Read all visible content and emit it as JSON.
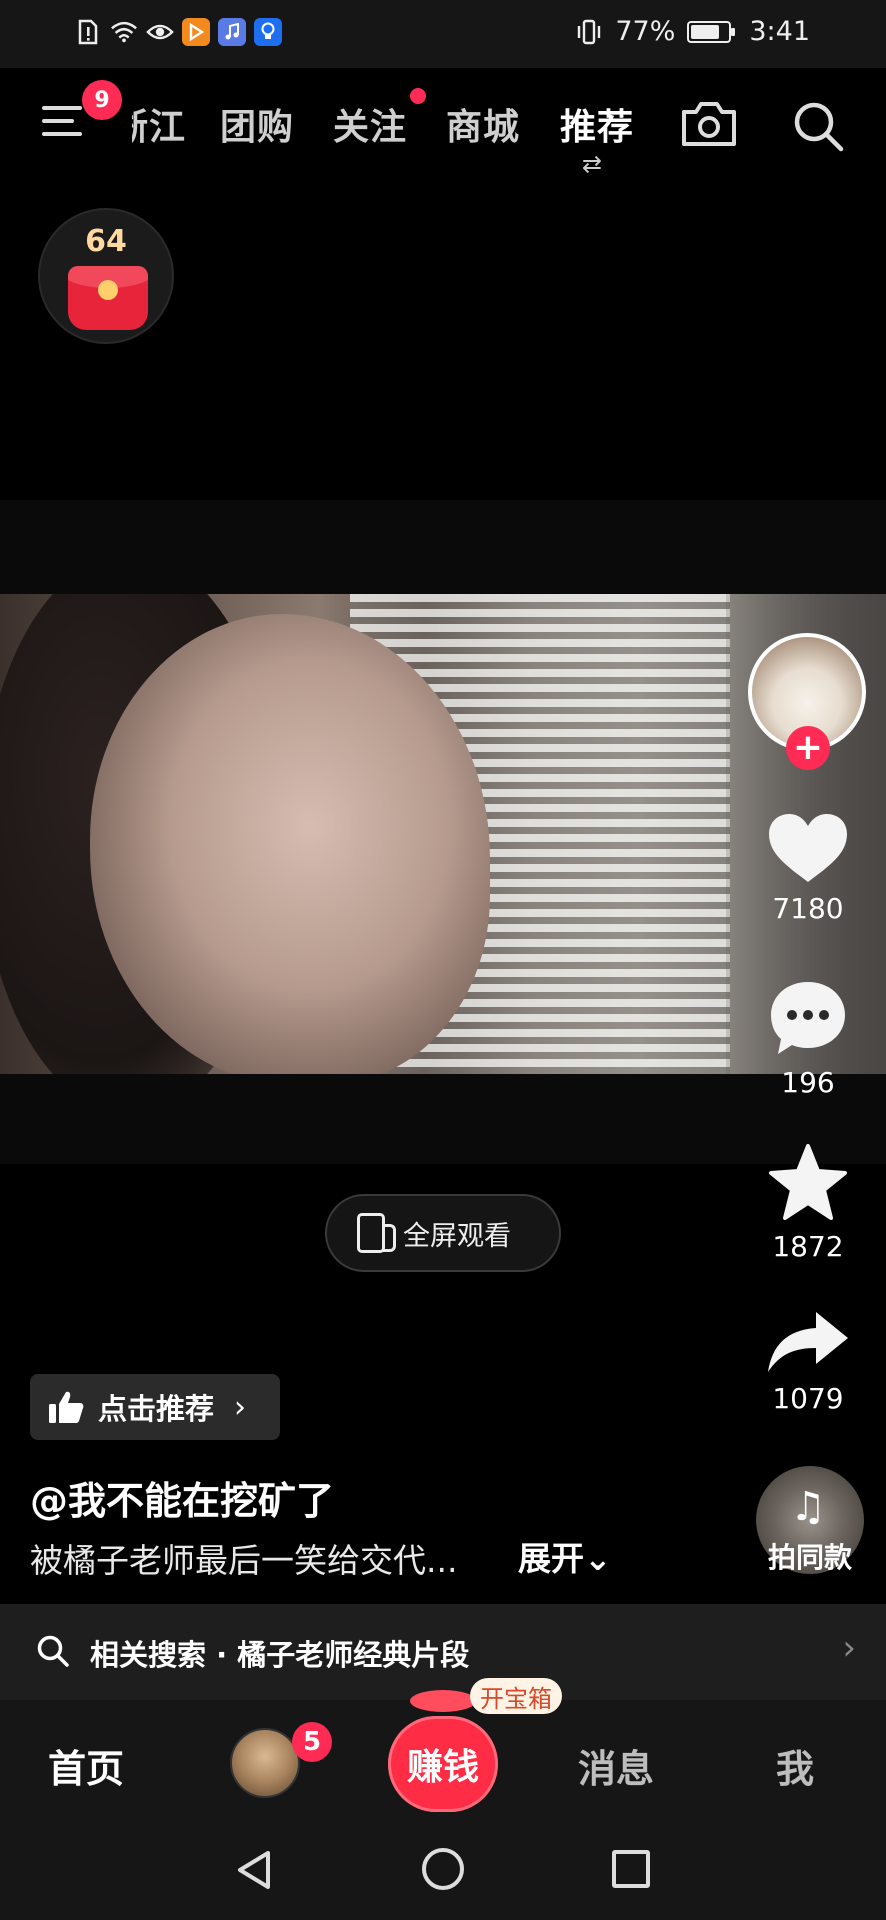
{
  "status_bar": {
    "battery_percent": "77%",
    "battery_level": 0.77,
    "time": "3:41",
    "icons": [
      "sim-alert-icon",
      "wifi-icon",
      "eye-comfort-icon",
      "app-play-icon",
      "app-music-icon",
      "app-bulb-icon",
      "vibrate-icon"
    ]
  },
  "top_nav": {
    "menu_badge": "9",
    "tabs": [
      {
        "label": "浙江",
        "active": false
      },
      {
        "label": "团购",
        "active": false
      },
      {
        "label": "关注",
        "active": false,
        "has_dot": true
      },
      {
        "label": "商城",
        "active": false
      },
      {
        "label": "推荐",
        "active": true
      }
    ],
    "switch_glyph": "⇄",
    "icons": [
      "camera-icon",
      "search-icon"
    ]
  },
  "red_packet": {
    "count": "64"
  },
  "video": {
    "fullscreen_label": "全屏观看"
  },
  "right_rail": {
    "follow_glyph": "+",
    "likes": "7180",
    "comments": "196",
    "favorites": "1872",
    "shares": "1079",
    "music_label": "拍同款",
    "music_glyph": "♫"
  },
  "info": {
    "recommend_label": "点击推荐",
    "recommend_chevron": "›",
    "author": "@我不能在挖矿了",
    "description": "被橘子老师最后一笑给交代...",
    "expand_label": "展开⌄"
  },
  "related_search": {
    "label": "相关搜索 · 橘子老师经典片段",
    "chevron": "›"
  },
  "bottom_tabs": {
    "home": "首页",
    "friends_badge": "5",
    "earn": "赚钱",
    "treasure_tag": "开宝箱",
    "messages": "消息",
    "me": "我"
  },
  "colors": {
    "accent": "#fe2c55",
    "background": "#000000",
    "bar": "#161616"
  }
}
